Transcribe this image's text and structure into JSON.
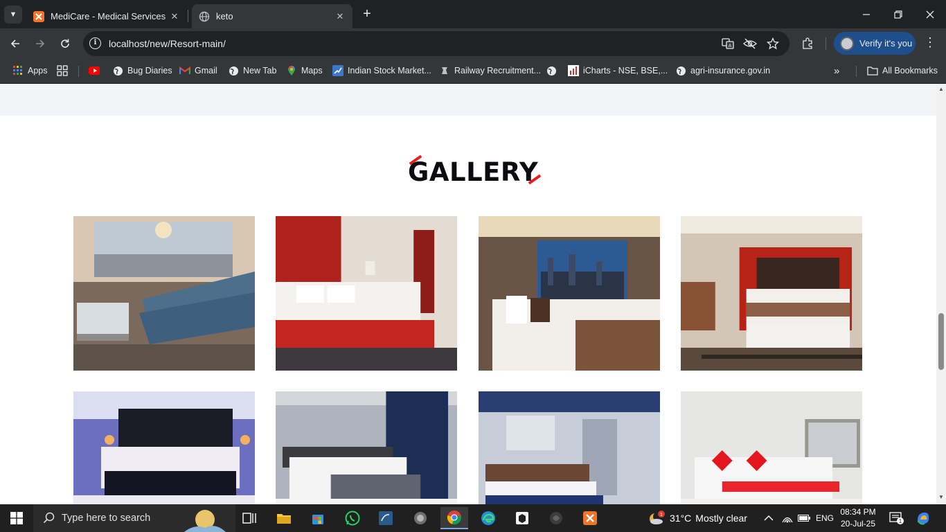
{
  "browser": {
    "tabs": [
      {
        "title": "MediCare - Medical Services",
        "active": false,
        "favicon": "xampp-icon"
      },
      {
        "title": "keto",
        "active": true,
        "favicon": "globe-icon"
      }
    ],
    "address": {
      "url": "localhost/new/Resort-main/"
    },
    "verify_label": "Verify it's you",
    "bookmarks": [
      {
        "label": "Apps",
        "icon": "apps-grid-icon"
      },
      {
        "label": "",
        "icon": "grid-icon"
      },
      {
        "label": "",
        "icon": "youtube-icon"
      },
      {
        "label": "Bug Diaries",
        "icon": "globe-icon"
      },
      {
        "label": "Gmail",
        "icon": "gmail-icon"
      },
      {
        "label": "New Tab",
        "icon": "globe-icon"
      },
      {
        "label": "Maps",
        "icon": "maps-icon"
      },
      {
        "label": "Indian Stock Market...",
        "icon": "stock-icon"
      },
      {
        "label": "Railway Recruitment...",
        "icon": "railway-icon"
      },
      {
        "label": "",
        "icon": "globe-icon"
      },
      {
        "label": "iCharts - NSE, BSE,...",
        "icon": "icharts-icon"
      },
      {
        "label": "agri-insurance.gov.in",
        "icon": "globe-icon"
      }
    ],
    "all_bookmarks_label": "All Bookmarks"
  },
  "page": {
    "gallery_title": "GALLERY",
    "accent_color": "#e2211c",
    "images": [
      {
        "name": "gallery-image-lounge"
      },
      {
        "name": "gallery-image-red-headboard"
      },
      {
        "name": "gallery-image-city-view"
      },
      {
        "name": "gallery-image-red-wall"
      },
      {
        "name": "gallery-image-blue-lit"
      },
      {
        "name": "gallery-image-grey-room"
      },
      {
        "name": "gallery-image-mirror-room"
      },
      {
        "name": "gallery-image-red-pillows"
      }
    ]
  },
  "taskbar": {
    "search_placeholder": "Type here to search",
    "weather": {
      "temp": "31°C",
      "condition": "Mostly clear"
    },
    "language": "ENG",
    "time": "08:34 PM",
    "date": "20-Jul-25",
    "notification_count": "1"
  }
}
